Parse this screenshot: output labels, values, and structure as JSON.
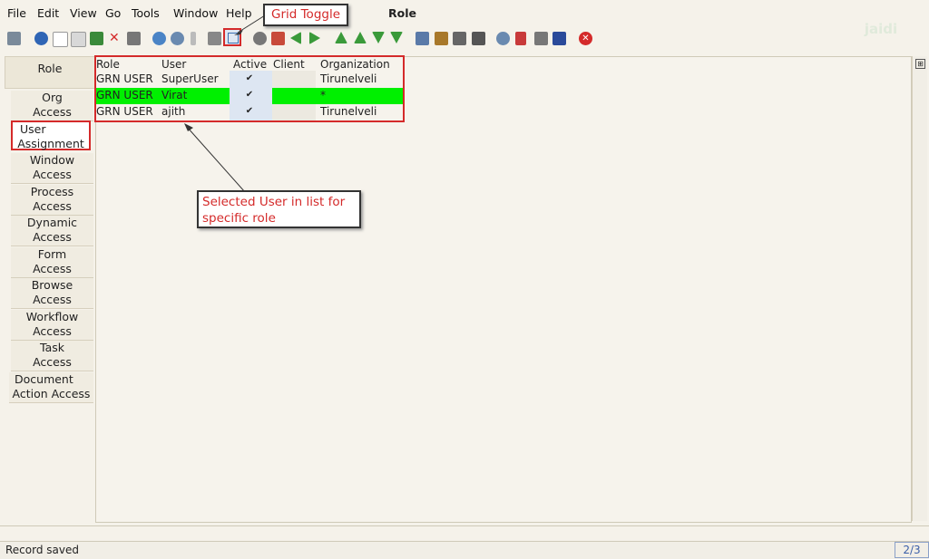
{
  "menu": {
    "file": "File",
    "edit": "Edit",
    "view": "View",
    "go": "Go",
    "tools": "Tools",
    "window": "Window",
    "help": "Help"
  },
  "window_title": "Role",
  "logo_text": "jaidi",
  "annotations": {
    "grid_toggle": "Grid Toggle",
    "selected_user_line1": "Selected User in list for",
    "selected_user_line2": "specific role"
  },
  "tabs": {
    "header": "Role",
    "items": [
      {
        "l1": "Org",
        "l2": "Access"
      },
      {
        "l1": "User",
        "l2": "Assignment"
      },
      {
        "l1": "Window",
        "l2": "Access"
      },
      {
        "l1": "Process",
        "l2": "Access"
      },
      {
        "l1": "Dynamic",
        "l2": "Access"
      },
      {
        "l1": "Form",
        "l2": "Access"
      },
      {
        "l1": "Browse",
        "l2": "Access"
      },
      {
        "l1": "Workflow",
        "l2": "Access"
      },
      {
        "l1": "Task",
        "l2": "Access"
      },
      {
        "l1": "Document",
        "l2": "Action Access"
      }
    ]
  },
  "grid": {
    "columns": [
      "Role",
      "User",
      "Active",
      "Client",
      "Organization"
    ],
    "rows": [
      {
        "role": "GRN USER",
        "user": "SuperUser",
        "active": "✔",
        "client": "",
        "org": "Tirunelveli"
      },
      {
        "role": "GRN USER",
        "user": "Virat",
        "active": "✔",
        "client": "",
        "org": "*"
      },
      {
        "role": "GRN USER",
        "user": "ajith",
        "active": "✔",
        "client": "",
        "org": "Tirunelveli"
      }
    ]
  },
  "status": {
    "message": "Record saved",
    "record_count": "2/3"
  },
  "colors": {
    "annotation_red": "#d42a2a",
    "selected_row": "#00f000"
  }
}
